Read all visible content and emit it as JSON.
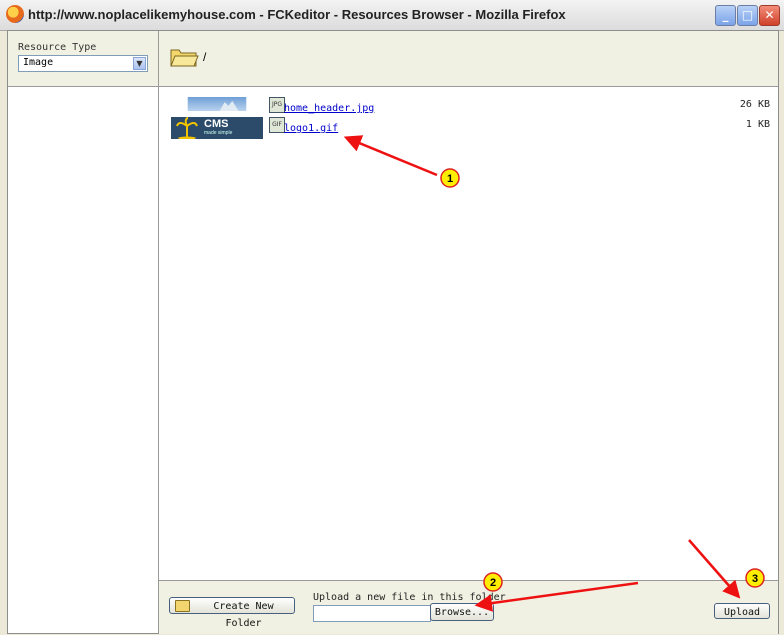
{
  "window": {
    "title": "http://www.noplacelikemyhouse.com - FCKeditor - Resources Browser - Mozilla Firefox",
    "minimize_glyph": "_",
    "maximize_glyph": "□",
    "close_glyph": "✕"
  },
  "sidebar": {
    "resource_type_label": "Resource Type",
    "resource_type_value": "Image",
    "dropdown_glyph": "▼"
  },
  "path": {
    "current": "/"
  },
  "files": [
    {
      "name": "home_header.jpg",
      "type_badge": "JPG",
      "size": "26 KB",
      "thumb": "sky-banner"
    },
    {
      "name": "logo1.gif",
      "type_badge": "GIF",
      "size": "1 KB",
      "thumb": "cms-logo",
      "logo_text": "CMS",
      "logo_subtext": "made simple"
    }
  ],
  "bottom": {
    "create_folder_label": "Create New Folder",
    "upload_caption": "Upload a new file in this folder",
    "browse_label": "Browse...",
    "upload_label": "Upload"
  },
  "callouts": [
    "1",
    "2",
    "3"
  ],
  "colors": {
    "accent_link": "#0000cc",
    "callout_fill": "#ffee00",
    "callout_stroke": "#dd2222",
    "arrow": "#ee1111"
  }
}
